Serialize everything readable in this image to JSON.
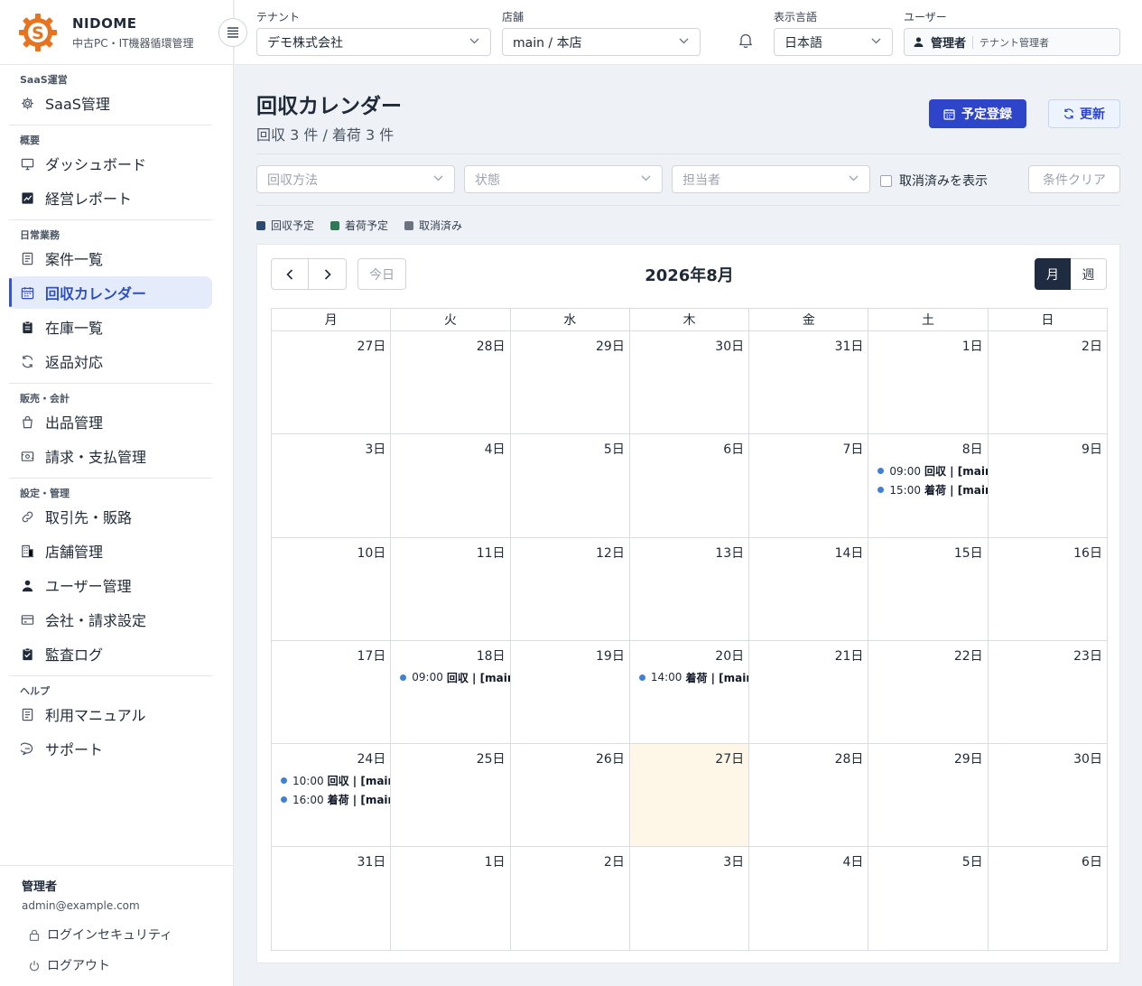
{
  "brand": {
    "name": "NIDOME",
    "subtitle": "中古PC・IT機器循環管理"
  },
  "sidebar": {
    "sections": [
      {
        "label": "SaaS運営",
        "items": [
          {
            "label": "SaaS管理",
            "icon": "gear-icon"
          }
        ]
      },
      {
        "label": "概要",
        "items": [
          {
            "label": "ダッシュボード",
            "icon": "monitor-icon"
          },
          {
            "label": "経営レポート",
            "icon": "chart-icon"
          }
        ]
      },
      {
        "label": "日常業務",
        "items": [
          {
            "label": "案件一覧",
            "icon": "document-icon"
          },
          {
            "label": "回収カレンダー",
            "icon": "calendar-icon",
            "active": true
          },
          {
            "label": "在庫一覧",
            "icon": "clipboard-icon"
          },
          {
            "label": "返品対応",
            "icon": "refresh-icon"
          }
        ]
      },
      {
        "label": "販売・会計",
        "items": [
          {
            "label": "出品管理",
            "icon": "bag-icon"
          },
          {
            "label": "請求・支払管理",
            "icon": "receipt-icon"
          }
        ]
      },
      {
        "label": "設定・管理",
        "items": [
          {
            "label": "取引先・販路",
            "icon": "link-icon"
          },
          {
            "label": "店舗管理",
            "icon": "building-icon"
          },
          {
            "label": "ユーザー管理",
            "icon": "user-icon"
          },
          {
            "label": "会社・請求設定",
            "icon": "card-icon"
          },
          {
            "label": "監査ログ",
            "icon": "clipboard-check-icon"
          }
        ]
      },
      {
        "label": "ヘルプ",
        "items": [
          {
            "label": "利用マニュアル",
            "icon": "document-icon"
          },
          {
            "label": "サポート",
            "icon": "chat-icon"
          }
        ]
      }
    ],
    "user": {
      "name": "管理者",
      "email": "admin@example.com"
    },
    "links": {
      "security": "ログインセキュリティ",
      "logout": "ログアウト"
    }
  },
  "topbar": {
    "tenant": {
      "label": "テナント",
      "value": "デモ株式会社"
    },
    "store": {
      "label": "店舗",
      "value": "main / 本店"
    },
    "language": {
      "label": "表示言語",
      "value": "日本語"
    },
    "user": {
      "label": "ユーザー",
      "name": "管理者",
      "role": "テナント管理者"
    }
  },
  "page": {
    "title": "回収カレンダー",
    "summary": "回収 3 件 / 着荷 3 件",
    "register_button": "予定登録",
    "refresh_button": "更新"
  },
  "filters": {
    "method_placeholder": "回収方法",
    "status_placeholder": "状態",
    "assignee_placeholder": "担当者",
    "show_cancelled": "取消済みを表示",
    "clear_button": "条件クリア"
  },
  "legend": [
    {
      "label": "回収予定",
      "color": "#2c4a6e"
    },
    {
      "label": "着荷予定",
      "color": "#2f7a55"
    },
    {
      "label": "取消済み",
      "color": "#6b7280"
    }
  ],
  "calendar": {
    "title": "2026年8月",
    "today_button": "今日",
    "view_month": "月",
    "view_week": "週",
    "weekdays": [
      "月",
      "火",
      "水",
      "木",
      "金",
      "土",
      "日"
    ],
    "weeks": [
      [
        {
          "day": "27日"
        },
        {
          "day": "28日"
        },
        {
          "day": "29日"
        },
        {
          "day": "30日"
        },
        {
          "day": "31日"
        },
        {
          "day": "1日"
        },
        {
          "day": "2日"
        }
      ],
      [
        {
          "day": "3日"
        },
        {
          "day": "4日"
        },
        {
          "day": "5日"
        },
        {
          "day": "6日"
        },
        {
          "day": "7日"
        },
        {
          "day": "8日",
          "events": [
            {
              "time": "09:00",
              "title": "回収 | [main"
            },
            {
              "time": "15:00",
              "title": "着荷 | [main]"
            }
          ]
        },
        {
          "day": "9日"
        }
      ],
      [
        {
          "day": "10日"
        },
        {
          "day": "11日"
        },
        {
          "day": "12日"
        },
        {
          "day": "13日"
        },
        {
          "day": "14日"
        },
        {
          "day": "15日"
        },
        {
          "day": "16日"
        }
      ],
      [
        {
          "day": "17日"
        },
        {
          "day": "18日",
          "events": [
            {
              "time": "09:00",
              "title": "回収 | [main"
            }
          ]
        },
        {
          "day": "19日"
        },
        {
          "day": "20日",
          "events": [
            {
              "time": "14:00",
              "title": "着荷 | [main]"
            }
          ]
        },
        {
          "day": "21日"
        },
        {
          "day": "22日"
        },
        {
          "day": "23日"
        }
      ],
      [
        {
          "day": "24日",
          "events": [
            {
              "time": "10:00",
              "title": "回収 | [main]"
            },
            {
              "time": "16:00",
              "title": "着荷 | [main]"
            }
          ]
        },
        {
          "day": "25日"
        },
        {
          "day": "26日"
        },
        {
          "day": "27日",
          "today": true
        },
        {
          "day": "28日"
        },
        {
          "day": "29日"
        },
        {
          "day": "30日"
        }
      ],
      [
        {
          "day": "31日"
        },
        {
          "day": "1日"
        },
        {
          "day": "2日"
        },
        {
          "day": "3日"
        },
        {
          "day": "4日"
        },
        {
          "day": "5日"
        },
        {
          "day": "6日"
        }
      ]
    ]
  }
}
